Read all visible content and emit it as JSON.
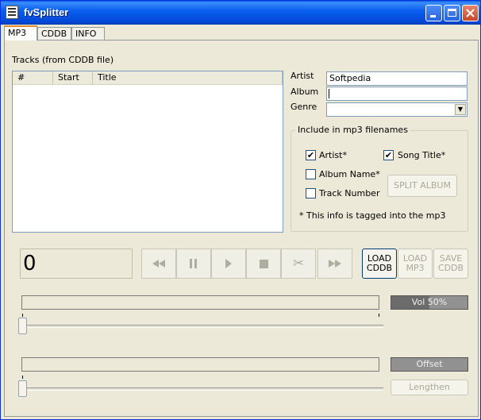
{
  "window": {
    "title": "fvSplitter"
  },
  "tabs": [
    {
      "label": "MP3"
    },
    {
      "label": "CDDB"
    },
    {
      "label": "INFO"
    }
  ],
  "tracks": {
    "label": "Tracks (from CDDB file)",
    "columns": [
      "#",
      "Start",
      "Title"
    ]
  },
  "fields": {
    "artist_label": "Artist",
    "artist_value": "Softpedia",
    "album_label": "Album",
    "album_value": "",
    "genre_label": "Genre",
    "genre_value": ""
  },
  "include": {
    "title": "Include in mp3 filenames",
    "artist": {
      "label": "Artist*",
      "checked": true
    },
    "song_title": {
      "label": "Song Title*",
      "checked": true
    },
    "album_name": {
      "label": "Album Name*",
      "checked": false
    },
    "track_number": {
      "label": "Track Number",
      "checked": false
    },
    "split_album": "SPLIT ALBUM",
    "note": "* This info is tagged into the mp3"
  },
  "player": {
    "time_display": "0",
    "load_cddb_line1": "LOAD",
    "load_cddb_line2": "CDDB",
    "load_mp3_line1": "LOAD",
    "load_mp3_line2": "MP3",
    "save_cddb_line1": "SAVE",
    "save_cddb_line2": "CDDB"
  },
  "volume": {
    "label": "Vol 50%",
    "level_percent": 50,
    "position_percent": 0
  },
  "offset": {
    "label": "Offset",
    "position_percent": 0,
    "lengthen_label": "Lengthen"
  },
  "icons": [
    "app-icon",
    "minimize-icon",
    "maximize-icon",
    "close-icon",
    "rewind-icon",
    "pause-icon",
    "play-icon",
    "stop-icon",
    "scissors-icon",
    "fast-forward-icon"
  ]
}
